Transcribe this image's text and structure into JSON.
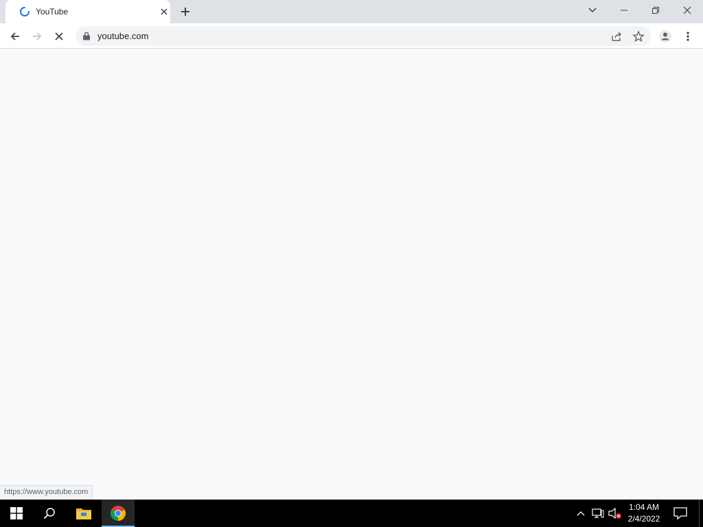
{
  "browser": {
    "tab": {
      "title": "YouTube",
      "loading": true
    },
    "toolbar": {
      "url": "youtube.com"
    },
    "status_url": "https://www.youtube.com"
  },
  "taskbar": {
    "time": "1:04 AM",
    "date": "2/4/2022",
    "accent_color": "#76b9ed",
    "pinned": [
      "start-icon",
      "search-icon",
      "file-explorer-icon",
      "chrome-icon"
    ],
    "tray": [
      "chevron-up-icon",
      "network-icon",
      "volume-muted-icon",
      "notification-icon"
    ]
  }
}
